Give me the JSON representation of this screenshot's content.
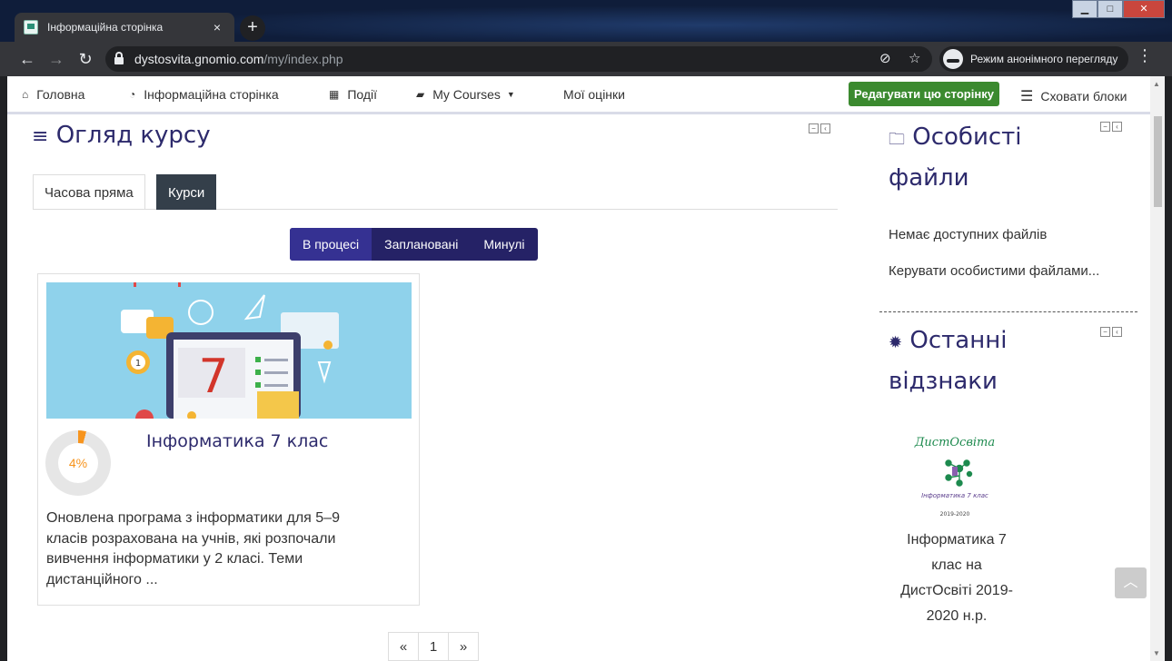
{
  "browser": {
    "tab_title": "Інформаційна сторінка",
    "tab_close": "×",
    "new_tab": "+",
    "url_host": "dystosvita.gnomio.com",
    "url_path": "/my/index.php",
    "incognito_label": "Режим анонімного перегляду"
  },
  "navbar": {
    "home": "Головна",
    "dashboard": "Інформаційна сторінка",
    "events": "Події",
    "my_courses": "My Courses",
    "grades": "Мої оцінки",
    "edit_page": "Редагувати цю сторінку",
    "hide_blocks": "Сховати блоки"
  },
  "course_overview": {
    "title": "Огляд курсу",
    "tabs": [
      "Часова пряма",
      "Курси"
    ],
    "active_tab": "Курси",
    "filters": [
      "В процесі",
      "Заплановані",
      "Минулі"
    ],
    "active_filter": "В процесі",
    "course": {
      "image_digit": "7",
      "image_badge": "1",
      "progress_percent": 4,
      "progress_label": "4%",
      "name": "Інформатика 7 клас",
      "description": "Оновлена програма з інформатики для 5–9 класів розрахована на учнів, які розпочали вивчення інформатики у 2 класі. Теми дистанційного ..."
    },
    "pagination": {
      "prev": "«",
      "page": "1",
      "next": "»"
    }
  },
  "private_files": {
    "title_line1": "Особисті",
    "title_line2": "файли",
    "empty_text": "Немає доступних файлів",
    "manage_link": "Керувати особистими файлами..."
  },
  "latest_badges": {
    "title_line1": "Останні",
    "title_line2": "відзнаки",
    "badge_logo_title": "ДистОсвіта",
    "badge_logo_subtitle": "Інформатика 7 клас",
    "badge_logo_year": "2019-2020",
    "badge_name": "Інформатика 7 клас на ДистОсвіті 2019-2020 н.р."
  },
  "colors": {
    "brand_dark": "#2d2a6c",
    "filter_bg": "#252266",
    "edit_button": "#3b8a2f",
    "progress": "#f7941d",
    "image_bg": "#8fd2eb"
  }
}
